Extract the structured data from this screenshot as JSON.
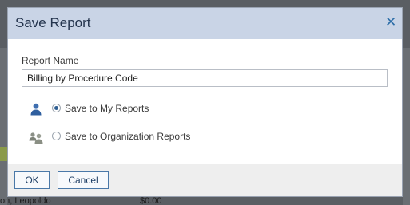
{
  "background": {
    "row_name": "on, Leopoldo",
    "row_amount": "$0.00"
  },
  "dialog": {
    "title": "Save Report",
    "close_icon": "close-x",
    "report_name_label": "Report Name",
    "report_name_value": "Billing by Procedure Code",
    "options": [
      {
        "label": "Save to My Reports",
        "checked": true,
        "icon": "single-user-icon"
      },
      {
        "label": "Save to Organization Reports",
        "checked": false,
        "icon": "group-users-icon"
      }
    ],
    "ok_label": "OK",
    "cancel_label": "Cancel"
  },
  "colors": {
    "header_bg": "#c9d4e6",
    "title": "#24344d",
    "accent": "#2d6ea8",
    "footer_bg": "#eeeeee"
  }
}
